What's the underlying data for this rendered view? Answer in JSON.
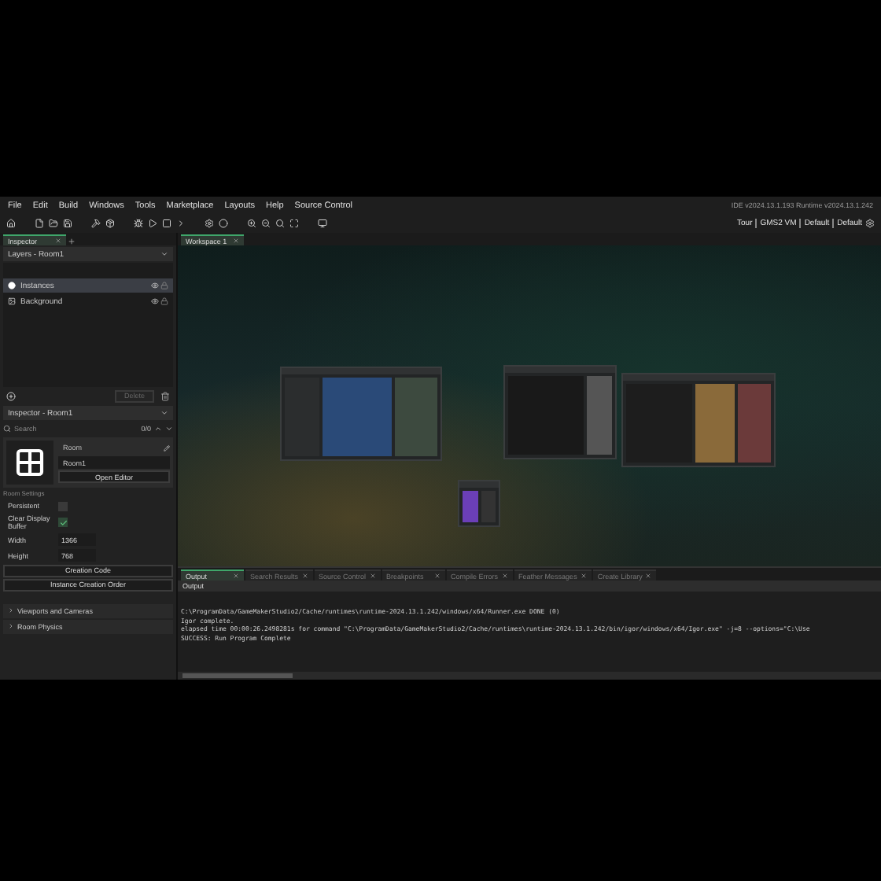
{
  "menu": [
    "File",
    "Edit",
    "Build",
    "Windows",
    "Tools",
    "Marketplace",
    "Layouts",
    "Help",
    "Source Control"
  ],
  "version": "IDE v2024.13.1.193 Runtime v2024.13.1.242",
  "targets": [
    "Tour",
    "GMS2 VM",
    "Default",
    "Default"
  ],
  "left_tabs": [
    {
      "label": "Inspector",
      "selected": true
    }
  ],
  "layers": {
    "title": "Layers - Room1",
    "items": [
      {
        "name": "Instances",
        "selected": true,
        "kind": "instances"
      },
      {
        "name": "Background",
        "selected": false,
        "kind": "background"
      }
    ],
    "delete_button": "Delete"
  },
  "inspector": {
    "title": "Inspector - Room1",
    "search": {
      "placeholder": "Search"
    },
    "count": "0/0",
    "room_label": "Room",
    "room_name": "Room1",
    "open_editor": "Open Editor",
    "section": "Room Settings",
    "checks": [
      {
        "label": "Persistent",
        "checked": false
      },
      {
        "label": "Clear Display Buffer",
        "checked": true
      }
    ],
    "fields": [
      {
        "label": "Width",
        "value": "1366"
      },
      {
        "label": "Height",
        "value": "768"
      }
    ],
    "buttons": [
      "Creation Code",
      "Instance Creation Order"
    ],
    "groups": [
      {
        "label": "Viewports and Cameras",
        "expanded": false
      },
      {
        "label": "Room Physics",
        "expanded": false
      }
    ]
  },
  "workspace_tabs": [
    {
      "label": "Workspace 1",
      "selected": true
    }
  ],
  "canvas_windows": [
    {
      "kind": "events"
    },
    {
      "kind": "room"
    },
    {
      "kind": "sprite"
    },
    {
      "kind": "small"
    }
  ],
  "output_tabs": [
    {
      "label": "Output",
      "selected": true
    },
    {
      "label": "Search Results",
      "selected": false
    },
    {
      "label": "Source Control",
      "selected": false
    },
    {
      "label": "Breakpoints",
      "selected": false
    },
    {
      "label": "Compile Errors",
      "selected": false
    },
    {
      "label": "Feather Messages",
      "selected": false
    },
    {
      "label": "Create Library",
      "selected": false
    }
  ],
  "output": {
    "title": "Output",
    "lines": [
      "C:\\ProgramData/GameMakerStudio2/Cache/runtimes\\runtime-2024.13.1.242/windows/x64/Runner.exe DONE (0)",
      "Igor complete.",
      "elapsed time 00:00:26.2498281s for command \"C:\\ProgramData/GameMakerStudio2/Cache/runtimes\\runtime-2024.13.1.242/bin/igor/windows/x64/Igor.exe\" -j=8 --options=\"C:\\Use",
      "SUCCESS: Run Program Complete"
    ]
  }
}
